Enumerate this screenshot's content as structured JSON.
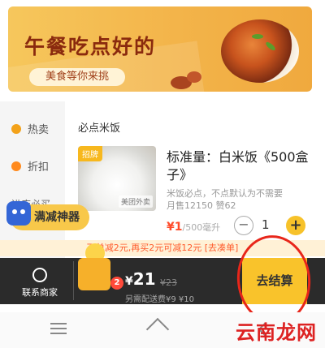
{
  "banner": {
    "title": "午餐吃点好的",
    "subtitle": "美食等你来挑"
  },
  "sidebar": {
    "items": [
      {
        "label": "热卖",
        "icon": "fire-icon"
      },
      {
        "label": "折扣",
        "icon": "discount-icon"
      }
    ],
    "cut_text": "进店必买"
  },
  "menu": {
    "section_title": "必点米饭",
    "item": {
      "tag": "招牌",
      "image_logo": "美团外卖",
      "name": "标准量：白米饭《500盒子》",
      "desc": "米饭必点，不点默认为不需要",
      "sales": "月售12150  赞62",
      "price": "¥1",
      "unit": "/500毫升",
      "minus": "−",
      "quantity": "1",
      "plus": "+"
    }
  },
  "reduce_badge": {
    "label": "满减神器"
  },
  "promo": {
    "text": "下单减2元,再买2元可减12元  [去凑单]"
  },
  "cart": {
    "contact_label": "联系商家",
    "count": "2",
    "total": "21",
    "currency": "¥",
    "original": "¥23",
    "delivery": "另需配送费¥9 ¥10",
    "checkout": "去结算"
  },
  "watermark": "云南龙网",
  "colors": {
    "accent": "#f9c32b",
    "price": "#ff4c2b",
    "circle": "#e8261a",
    "bar": "#2b2b2b"
  }
}
